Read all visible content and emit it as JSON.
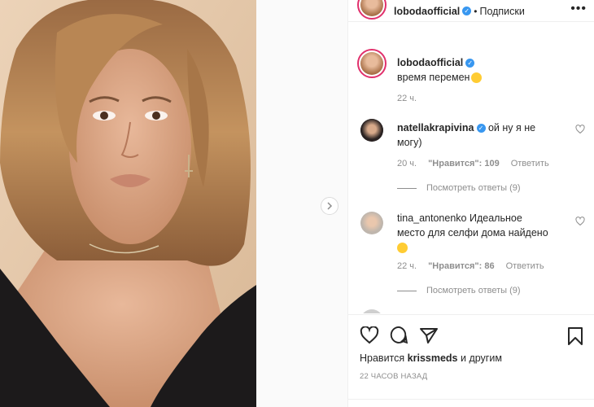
{
  "post": {
    "author": "lobodaofficial",
    "follow_label": "Подписки",
    "more_label": "•••",
    "caption": "время перемен",
    "caption_time": "22 ч."
  },
  "comments": [
    {
      "user": "natellakrapivina",
      "verified": true,
      "text_line1": "ой ну я не",
      "text_line2": "могу)",
      "time": "20 ч.",
      "likes": "\"Нравится\": 109",
      "reply": "Ответить",
      "view_replies": "Посмотреть ответы (9)"
    },
    {
      "user": "tina_antonenko",
      "verified": false,
      "text_line1": "Идеальное",
      "text_line2": "место для селфи дома найдено",
      "time": "22 ч.",
      "likes": "\"Нравится\": 86",
      "reply": "Ответить",
      "view_replies": "Посмотреть ответы (9)"
    }
  ],
  "likes_line": {
    "prefix": "Нравится",
    "user": "krissmeds",
    "suffix": "и другим"
  },
  "timestamp": "22 ЧАСОВ НАЗАД",
  "colors": {
    "verified": "#3897f0",
    "story_ring": "#e1306c",
    "muted": "#8e8e8e"
  },
  "icons": [
    "chevron-right-icon",
    "verified-icon",
    "heart-icon",
    "comment-icon",
    "share-icon",
    "bookmark-icon",
    "more-icon"
  ]
}
